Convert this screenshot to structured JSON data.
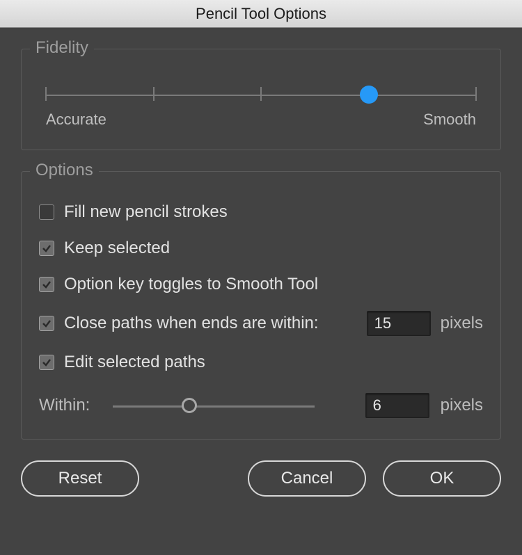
{
  "window": {
    "title": "Pencil Tool Options"
  },
  "fidelity": {
    "legend": "Fidelity",
    "left_label": "Accurate",
    "right_label": "Smooth",
    "ticks": 5,
    "value_index": 3
  },
  "options": {
    "legend": "Options",
    "fill_new": {
      "label": "Fill new pencil strokes",
      "checked": false
    },
    "keep_selected": {
      "label": "Keep selected",
      "checked": true
    },
    "option_key": {
      "label": "Option key toggles to Smooth Tool",
      "checked": true
    },
    "close_paths": {
      "label": "Close paths when ends are within:",
      "checked": true,
      "value": "15",
      "unit": "pixels"
    },
    "edit_selected": {
      "label": "Edit selected paths",
      "checked": true
    },
    "within": {
      "label": "Within:",
      "value": "6",
      "unit": "pixels",
      "slider_percent": 38
    }
  },
  "buttons": {
    "reset": "Reset",
    "cancel": "Cancel",
    "ok": "OK"
  }
}
